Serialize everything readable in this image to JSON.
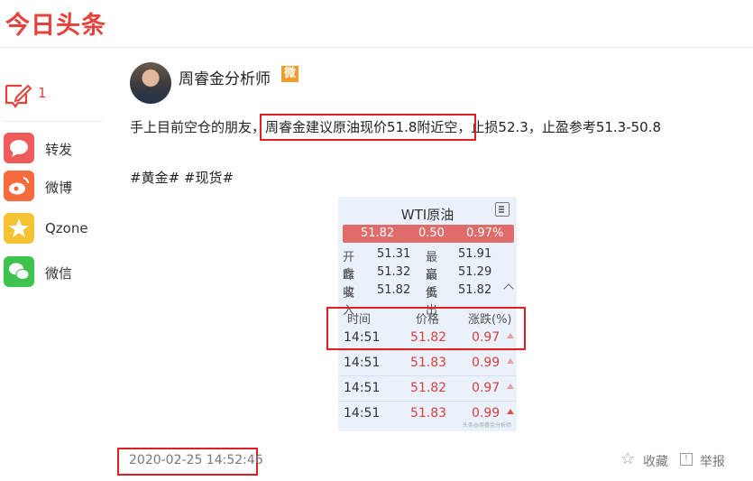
{
  "header": {
    "logo_text": "今日头条"
  },
  "sidebar": {
    "comment_count": "1",
    "share_items": [
      {
        "label": "转发",
        "icon": "repost-bubble-icon",
        "color": "#ef5a5a"
      },
      {
        "label": "微博",
        "icon": "weibo-icon",
        "color": "#f76a3b"
      },
      {
        "label": "Qzone",
        "icon": "qzone-star-icon",
        "color": "#f5c233"
      },
      {
        "label": "微信",
        "icon": "wechat-icon",
        "color": "#3dc34e"
      }
    ]
  },
  "post": {
    "author_name": "周睿金分析师",
    "author_badge": "微头条",
    "text_before": "手上目前空仓的朋友，",
    "text_highlight": "周睿金建议原油现价51.8附近空，",
    "text_after": "止损52.3，止盈参考51.3-50.8",
    "tags": "#黄金# #现货#",
    "timestamp": "2020-02-25 14:52:46"
  },
  "quote_card": {
    "title": "WTI原油",
    "price": "51.82",
    "change": "0.50",
    "change_pct": "0.97%",
    "open_label": "开盘",
    "open": "51.31",
    "high_label": "最高",
    "high": "51.91",
    "prev_close_label": "昨收",
    "prev_close": "51.32",
    "low_label": "最低",
    "low": "51.29",
    "bid_label": "买入",
    "bid": "51.82",
    "ask_label": "卖出",
    "ask": "51.82",
    "col_time": "时间",
    "col_price": "价格",
    "col_change": "涨跌(%)",
    "rows": [
      {
        "time": "14:51",
        "price": "51.82",
        "change": "0.97"
      },
      {
        "time": "14:51",
        "price": "51.83",
        "change": "0.99"
      },
      {
        "time": "14:51",
        "price": "51.82",
        "change": "0.97"
      },
      {
        "time": "14:51",
        "price": "51.83",
        "change": "0.99"
      }
    ],
    "watermark": "头条@周睿金分析师"
  },
  "actions": {
    "favorite_label": "收藏",
    "report_label": "举报"
  }
}
